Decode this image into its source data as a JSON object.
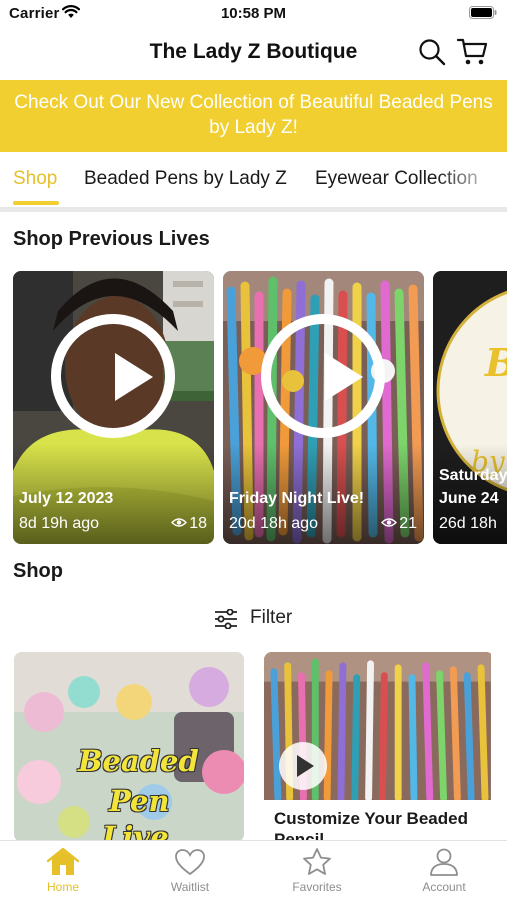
{
  "status_bar": {
    "carrier": "Carrier",
    "time": "10:58 PM"
  },
  "header": {
    "title": "The Lady Z Boutique",
    "icons": [
      "search-icon",
      "cart-icon"
    ]
  },
  "promo": {
    "text": "Check Out Our New Collection of Beautiful Beaded Pens by Lady Z!"
  },
  "tabs": [
    {
      "label": "Shop",
      "active": true
    },
    {
      "label": "Beaded Pens by Lady Z",
      "active": false
    },
    {
      "label": "Eyewear Collection",
      "active": false
    }
  ],
  "previous_lives": {
    "title": "Shop Previous Lives",
    "items": [
      {
        "title": "July 12 2023",
        "ago": "8d 19h ago",
        "views": "18"
      },
      {
        "title": "Friday Night Live!",
        "ago": "20d 18h ago",
        "views": "21"
      },
      {
        "title": "Saturday",
        "ago": "26d 18h",
        "views": "",
        "subtitle": "June 24"
      }
    ]
  },
  "shop": {
    "title": "Shop",
    "filter_label": "Filter",
    "products": [
      {
        "caption": "",
        "overlay_lines": [
          "Beaded",
          "Pen",
          "Live"
        ]
      },
      {
        "caption": "Customize Your Beaded Pencil"
      }
    ]
  },
  "bottom_tabs": [
    {
      "label": "Home",
      "icon": "home-icon",
      "active": true
    },
    {
      "label": "Waitlist",
      "icon": "heart-icon",
      "active": false
    },
    {
      "label": "Favorites",
      "icon": "star-icon",
      "active": false
    },
    {
      "label": "Account",
      "icon": "person-icon",
      "active": false
    }
  ],
  "colors": {
    "accent": "#f1cf31",
    "accent_text": "#e6c029",
    "inactive": "#8e8e8e"
  }
}
